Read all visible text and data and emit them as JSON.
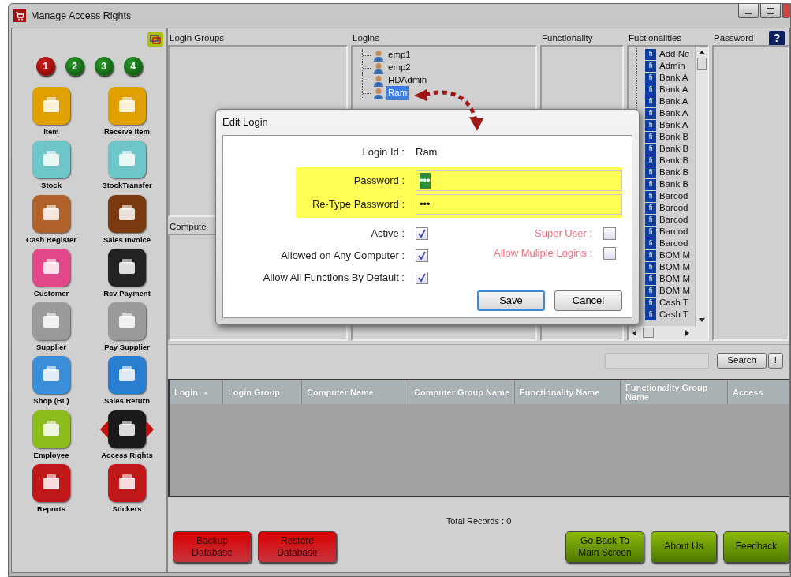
{
  "window": {
    "title": "Manage Access Rights"
  },
  "sidebar": {
    "steps": [
      {
        "label": "1",
        "selected": true
      },
      {
        "label": "2",
        "selected": false
      },
      {
        "label": "3",
        "selected": false
      },
      {
        "label": "4",
        "selected": false
      }
    ],
    "apps": [
      {
        "label": "Item",
        "color": "#e0a000",
        "selected": false
      },
      {
        "label": "Receive Item",
        "color": "#e0a000",
        "selected": false
      },
      {
        "label": "Stock",
        "color": "#6fc6c8",
        "selected": false
      },
      {
        "label": "StockTransfer",
        "color": "#6fc6c8",
        "selected": false
      },
      {
        "label": "Cash Register",
        "color": "#b0622a",
        "selected": false
      },
      {
        "label": "Sales Invoice",
        "color": "#7a3a10",
        "selected": false
      },
      {
        "label": "Customer",
        "color": "#e2478a",
        "selected": false
      },
      {
        "label": "Rcv Payment",
        "color": "#222222",
        "selected": false
      },
      {
        "label": "Supplier",
        "color": "#9a9a9a",
        "selected": false
      },
      {
        "label": "Pay Supplier",
        "color": "#9a9a9a",
        "selected": false
      },
      {
        "label": "Shop (BL)",
        "color": "#3a8fd8",
        "selected": false
      },
      {
        "label": "Sales Return",
        "color": "#2a7ed0",
        "selected": false
      },
      {
        "label": "Employee",
        "color": "#8cbc1c",
        "selected": false
      },
      {
        "label": "Access Rights",
        "color": "#1a1a1a",
        "selected": true
      },
      {
        "label": "Reports",
        "color": "#c01818",
        "selected": false
      },
      {
        "label": "Stickers",
        "color": "#c01818",
        "selected": false
      }
    ]
  },
  "panels": {
    "login_groups": {
      "title": "Login Groups"
    },
    "computers": {
      "title": "Compute"
    },
    "logins": {
      "title": "Logins",
      "items": [
        {
          "label": "emp1",
          "selected": false
        },
        {
          "label": "emp2",
          "selected": false
        },
        {
          "label": "HDAdmin",
          "selected": false
        },
        {
          "label": "Ram",
          "selected": true
        }
      ]
    },
    "functionality": {
      "title": "Functionality"
    },
    "functionalities": {
      "title": "Fuctionalities",
      "items": [
        {
          "icon": "fi",
          "label": "Add Ne"
        },
        {
          "icon": "fi",
          "label": "Admin"
        },
        {
          "icon": "fi",
          "label": "Bank A"
        },
        {
          "icon": "fi",
          "label": "Bank A"
        },
        {
          "icon": "fi",
          "label": "Bank A"
        },
        {
          "icon": "fi",
          "label": "Bank A"
        },
        {
          "icon": "fi",
          "label": "Bank A"
        },
        {
          "icon": "fi",
          "label": "Bank B"
        },
        {
          "icon": "fi",
          "label": "Bank B"
        },
        {
          "icon": "fi",
          "label": "Bank B"
        },
        {
          "icon": "fi",
          "label": "Bank B"
        },
        {
          "icon": "fi",
          "label": "Bank B"
        },
        {
          "icon": "fi",
          "label": "Barcod"
        },
        {
          "icon": "fi",
          "label": "Barcod"
        },
        {
          "icon": "fi",
          "label": "Barcod"
        },
        {
          "icon": "fi",
          "label": "Barcod"
        },
        {
          "icon": "fi",
          "label": "Barcod"
        },
        {
          "icon": "fi",
          "label": "BOM M"
        },
        {
          "icon": "fi",
          "label": "BOM M"
        },
        {
          "icon": "fi",
          "label": "BOM M"
        },
        {
          "icon": "fi",
          "label": "BOM M"
        },
        {
          "icon": "fi",
          "label": "Cash T"
        },
        {
          "icon": "fi",
          "label": "Cash T"
        }
      ]
    },
    "password": {
      "title": "Password"
    },
    "help": "?"
  },
  "search": {
    "button": "Search",
    "extra_button": "!"
  },
  "grid": {
    "columns": [
      {
        "label": "Login",
        "sorted": true
      },
      {
        "label": "Login Group",
        "sorted": false
      },
      {
        "label": "Computer Name",
        "sorted": false
      },
      {
        "label": "Computer Group Name",
        "sorted": false
      },
      {
        "label": "Functionality Name",
        "sorted": false
      },
      {
        "label": "Functionality Group Name",
        "sorted": false
      },
      {
        "label": "Access",
        "sorted": false
      }
    ]
  },
  "total_records": "Total Records : 0",
  "footer_buttons": [
    {
      "label": "Backup Database",
      "kind": "danger"
    },
    {
      "label": "Restore Database",
      "kind": "danger"
    },
    {
      "label": "Go Back To Main Screen",
      "kind": "go"
    },
    {
      "label": "About Us",
      "kind": "go"
    },
    {
      "label": "Feedback",
      "kind": "go"
    }
  ],
  "dialog": {
    "title": "Edit Login",
    "login_id_label": "Login Id :",
    "login_id_value": "Ram",
    "fields": [
      {
        "label": "Password :",
        "value": "•••",
        "selected": true
      },
      {
        "label": "Re-Type Password :",
        "value": "•••",
        "selected": false
      }
    ],
    "checks_left": [
      {
        "label": "Active :",
        "checked": true,
        "disabled": false
      },
      {
        "label": "Allowed on Any Computer :",
        "checked": true,
        "disabled": false
      },
      {
        "label": "Allow All Functions By Default :",
        "checked": true,
        "disabled": false
      }
    ],
    "checks_right": [
      {
        "label": "Super User :",
        "checked": false,
        "disabled": true
      },
      {
        "label": "Allow Muliple Logins :",
        "checked": false,
        "disabled": true
      }
    ],
    "buttons": [
      {
        "label": "Save",
        "default": true
      },
      {
        "label": "Cancel",
        "default": false
      }
    ]
  }
}
